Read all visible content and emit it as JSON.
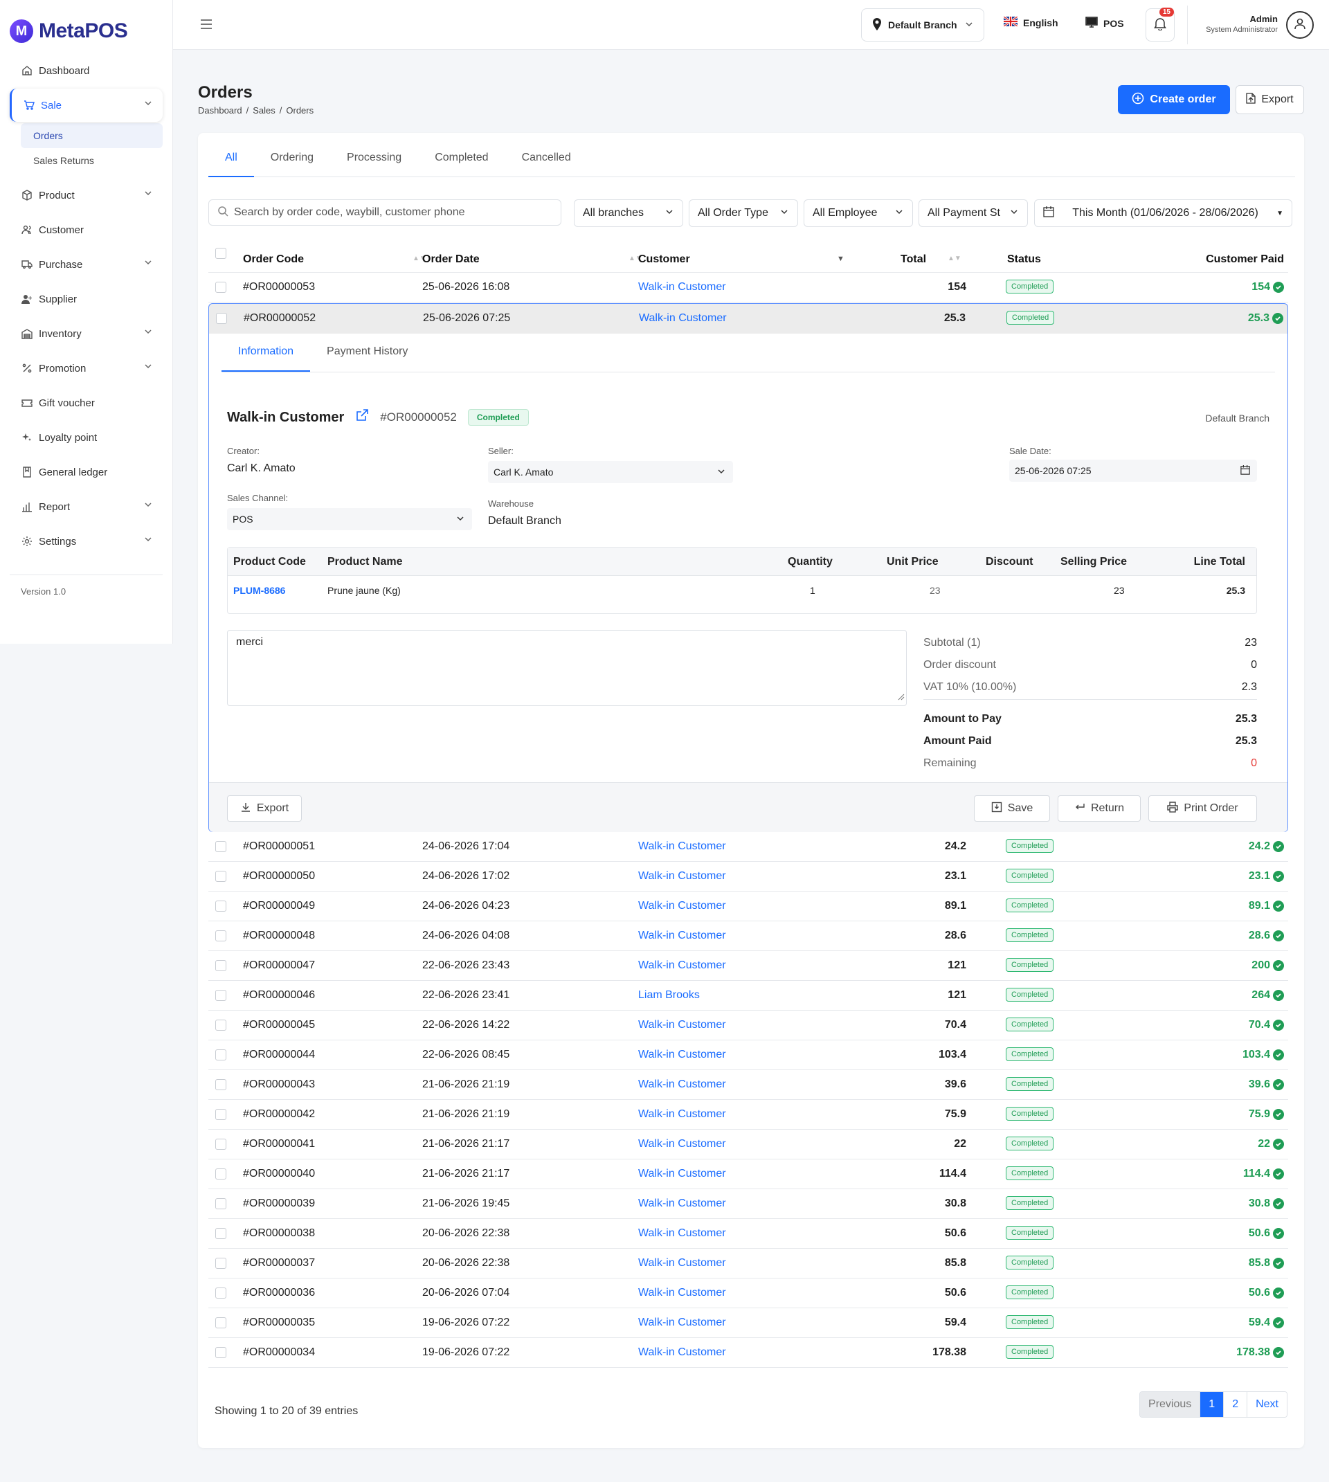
{
  "brand": {
    "name": "MetaPOS",
    "mark": "M"
  },
  "sidebar": {
    "items": [
      {
        "label": "Dashboard",
        "icon": "home-icon"
      },
      {
        "label": "Sale",
        "icon": "cart-icon",
        "expanded": true
      },
      {
        "label": "Product",
        "icon": "box-icon"
      },
      {
        "label": "Customer",
        "icon": "users-icon"
      },
      {
        "label": "Purchase",
        "icon": "truck-icon"
      },
      {
        "label": "Supplier",
        "icon": "user-plus-icon"
      },
      {
        "label": "Inventory",
        "icon": "warehouse-icon"
      },
      {
        "label": "Promotion",
        "icon": "percent-icon"
      },
      {
        "label": "Gift voucher",
        "icon": "ticket-icon"
      },
      {
        "label": "Loyalty point",
        "icon": "sparkle-icon"
      },
      {
        "label": "General ledger",
        "icon": "book-icon"
      },
      {
        "label": "Report",
        "icon": "bar-chart-icon"
      },
      {
        "label": "Settings",
        "icon": "gear-icon"
      }
    ],
    "sale_sub": [
      "Orders",
      "Sales Returns"
    ],
    "version": "Version 1.0"
  },
  "topbar": {
    "branch": "Default Branch",
    "language": "English",
    "pos": "POS",
    "notifications": "15",
    "user_name": "Admin",
    "user_role": "System Administrator"
  },
  "page": {
    "title": "Orders",
    "breadcrumb": [
      "Dashboard",
      "Sales",
      "Orders"
    ],
    "create_button": "Create order",
    "export_button": "Export"
  },
  "tabs": [
    "All",
    "Ordering",
    "Processing",
    "Completed",
    "Cancelled"
  ],
  "filters": {
    "search_placeholder": "Search by order code, waybill, customer phone",
    "branches": "All branches",
    "order_type": "All Order Type",
    "employee": "All Employee",
    "payment": "All Payment St",
    "date_range": "This Month (01/06/2026 - 28/06/2026)"
  },
  "table": {
    "headers": {
      "code": "Order Code",
      "date": "Order Date",
      "customer": "Customer",
      "total": "Total",
      "status": "Status",
      "paid": "Customer Paid"
    },
    "rows_top": [
      {
        "code": "#OR00000053",
        "date": "25-06-2026 16:08",
        "customer": "Walk-in Customer",
        "total": "154",
        "status": "Completed",
        "paid": "154"
      },
      {
        "code": "#OR00000052",
        "date": "25-06-2026 07:25",
        "customer": "Walk-in Customer",
        "total": "25.3",
        "status": "Completed",
        "paid": "25.3"
      }
    ],
    "rows_bottom": [
      {
        "code": "#OR00000051",
        "date": "24-06-2026 17:04",
        "customer": "Walk-in Customer",
        "total": "24.2",
        "status": "Completed",
        "paid": "24.2"
      },
      {
        "code": "#OR00000050",
        "date": "24-06-2026 17:02",
        "customer": "Walk-in Customer",
        "total": "23.1",
        "status": "Completed",
        "paid": "23.1"
      },
      {
        "code": "#OR00000049",
        "date": "24-06-2026 04:23",
        "customer": "Walk-in Customer",
        "total": "89.1",
        "status": "Completed",
        "paid": "89.1"
      },
      {
        "code": "#OR00000048",
        "date": "24-06-2026 04:08",
        "customer": "Walk-in Customer",
        "total": "28.6",
        "status": "Completed",
        "paid": "28.6"
      },
      {
        "code": "#OR00000047",
        "date": "22-06-2026 23:43",
        "customer": "Walk-in Customer",
        "total": "121",
        "status": "Completed",
        "paid": "200"
      },
      {
        "code": "#OR00000046",
        "date": "22-06-2026 23:41",
        "customer": "Liam Brooks",
        "total": "121",
        "status": "Completed",
        "paid": "264"
      },
      {
        "code": "#OR00000045",
        "date": "22-06-2026 14:22",
        "customer": "Walk-in Customer",
        "total": "70.4",
        "status": "Completed",
        "paid": "70.4"
      },
      {
        "code": "#OR00000044",
        "date": "22-06-2026 08:45",
        "customer": "Walk-in Customer",
        "total": "103.4",
        "status": "Completed",
        "paid": "103.4"
      },
      {
        "code": "#OR00000043",
        "date": "21-06-2026 21:19",
        "customer": "Walk-in Customer",
        "total": "39.6",
        "status": "Completed",
        "paid": "39.6"
      },
      {
        "code": "#OR00000042",
        "date": "21-06-2026 21:19",
        "customer": "Walk-in Customer",
        "total": "75.9",
        "status": "Completed",
        "paid": "75.9"
      },
      {
        "code": "#OR00000041",
        "date": "21-06-2026 21:17",
        "customer": "Walk-in Customer",
        "total": "22",
        "status": "Completed",
        "paid": "22"
      },
      {
        "code": "#OR00000040",
        "date": "21-06-2026 21:17",
        "customer": "Walk-in Customer",
        "total": "114.4",
        "status": "Completed",
        "paid": "114.4"
      },
      {
        "code": "#OR00000039",
        "date": "21-06-2026 19:45",
        "customer": "Walk-in Customer",
        "total": "30.8",
        "status": "Completed",
        "paid": "30.8"
      },
      {
        "code": "#OR00000038",
        "date": "20-06-2026 22:38",
        "customer": "Walk-in Customer",
        "total": "50.6",
        "status": "Completed",
        "paid": "50.6"
      },
      {
        "code": "#OR00000037",
        "date": "20-06-2026 22:38",
        "customer": "Walk-in Customer",
        "total": "85.8",
        "status": "Completed",
        "paid": "85.8"
      },
      {
        "code": "#OR00000036",
        "date": "20-06-2026 07:04",
        "customer": "Walk-in Customer",
        "total": "50.6",
        "status": "Completed",
        "paid": "50.6"
      },
      {
        "code": "#OR00000035",
        "date": "19-06-2026 07:22",
        "customer": "Walk-in Customer",
        "total": "59.4",
        "status": "Completed",
        "paid": "59.4"
      },
      {
        "code": "#OR00000034",
        "date": "19-06-2026 07:22",
        "customer": "Walk-in Customer",
        "total": "178.38",
        "status": "Completed",
        "paid": "178.38"
      }
    ]
  },
  "detail": {
    "tabs": [
      "Information",
      "Payment History"
    ],
    "customer": "Walk-in Customer",
    "code": "#OR00000052",
    "status": "Completed",
    "branch": "Default Branch",
    "creator_label": "Creator:",
    "creator": "Carl K. Amato",
    "seller_label": "Seller:",
    "seller": "Carl K. Amato",
    "sale_date_label": "Sale Date:",
    "sale_date": "25-06-2026 07:25",
    "channel_label": "Sales Channel:",
    "channel": "POS",
    "warehouse_label": "Warehouse",
    "warehouse": "Default Branch",
    "items_headers": {
      "code": "Product Code",
      "name": "Product Name",
      "qty": "Quantity",
      "unit": "Unit Price",
      "discount": "Discount",
      "selling": "Selling Price",
      "line": "Line Total"
    },
    "item": {
      "code": "PLUM-8686",
      "name": "Prune jaune (Kg)",
      "qty": "1",
      "unit": "23",
      "discount": "",
      "selling": "23",
      "line": "25.3"
    },
    "note": "merci",
    "summary": {
      "subtotal_label": "Subtotal (1)",
      "subtotal": "23",
      "discount_label": "Order discount",
      "discount": "0",
      "vat_label": "VAT 10% (10.00%)",
      "vat": "2.3",
      "pay_label": "Amount to Pay",
      "pay": "25.3",
      "paid_label": "Amount Paid",
      "paid": "25.3",
      "remaining_label": "Remaining",
      "remaining": "0"
    },
    "buttons": {
      "export": "Export",
      "save": "Save",
      "return": "Return",
      "print": "Print Order"
    }
  },
  "pagination": {
    "showing": "Showing 1 to 20 of 39 entries",
    "previous": "Previous",
    "pages": [
      "1",
      "2"
    ],
    "next": "Next"
  },
  "colors": {
    "accent": "#1a6cff",
    "success": "#1f9d55",
    "danger": "#e53935"
  }
}
